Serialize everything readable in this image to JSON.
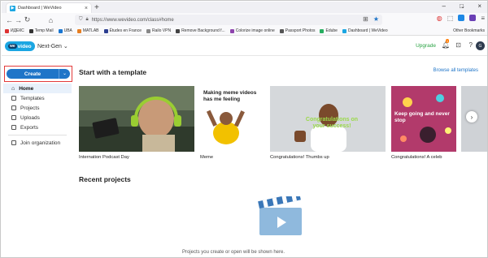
{
  "browser": {
    "tab_title": "Dashboard | WeVideo",
    "url": "https://www.wevideo.com/class#home",
    "bookmarks": [
      "ИДЕКС",
      "Temp Mail",
      "UBA",
      "MATLAB",
      "Études en France",
      "Railo VPN",
      "Remove Background f...",
      "Colorize image online",
      "Passport Photos",
      "Edube",
      "Dashboard | WeVideo"
    ],
    "other_bookmarks": "Other Bookmarks"
  },
  "app": {
    "logo_we": "we",
    "logo_video": "video",
    "edition": "Next-Gen",
    "upgrade": "Upgrade",
    "notification_count": "1",
    "avatar_initials": "G"
  },
  "sidebar": {
    "create_label": "Create",
    "items": [
      {
        "label": "Home"
      },
      {
        "label": "Templates"
      },
      {
        "label": "Projects"
      },
      {
        "label": "Uploads"
      },
      {
        "label": "Exports"
      },
      {
        "label": "Join organization"
      }
    ]
  },
  "main": {
    "template_heading": "Start with a template",
    "browse_all": "Browse all templates",
    "cards": [
      {
        "label": "Internation Podcast Day"
      },
      {
        "label": "Meme",
        "overlay": "Making meme videos has me feeling"
      },
      {
        "label": "Congratulations! Thumbs up",
        "overlay": "Congratulations on your success!"
      },
      {
        "label": "Congratulations! A celeb",
        "overlay": "Keep going and never stop"
      }
    ],
    "recent_heading": "Recent projects",
    "empty_message": "Projects you create or open will be shown here."
  },
  "colors": {
    "accent": "#1f75c8",
    "logo": "#1ba6e2",
    "upgrade": "#2aa344",
    "highlight_border": "#e33b3b"
  }
}
